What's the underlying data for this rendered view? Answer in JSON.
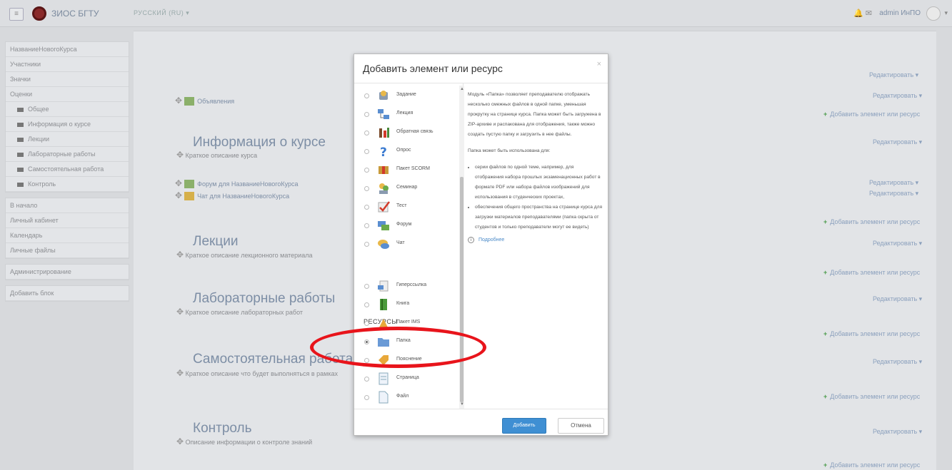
{
  "header": {
    "menu_icon": "menu-icon",
    "logo_icon": "university-seal-logo",
    "brand": "ЗИОС БГТУ",
    "language": "РУССКИЙ (RU) ▾",
    "user": "admin ИнПО",
    "dropdown": "▾"
  },
  "sidebar": {
    "course": [
      "НазваниеНовогоКурса",
      "Участники",
      "Значки",
      "Оценки",
      "Общее",
      "Информация о курсе",
      "Лекции",
      "Лабораторные работы",
      "Самостоятельная работа",
      "Контроль"
    ],
    "nav": [
      "В начало",
      "Личный кабинет",
      "Календарь",
      "Личные файлы"
    ],
    "admin": "Администрирование",
    "addblock": "Добавить блок"
  },
  "main": {
    "edit": "Редактировать ▾",
    "add": "Добавить элемент или ресурс",
    "news": "Объявления",
    "sections": [
      {
        "title": "Информация о курсе",
        "summary": "Краткое описание курса"
      },
      {
        "title": "Лекции",
        "summary": "Краткое описание лекционного материала"
      },
      {
        "title": "Лабораторные работы",
        "summary": "Краткое описание лабораторных работ"
      },
      {
        "title": "Самостоятельная работа",
        "summary": "Краткое описание что будет выполняться в рамках"
      },
      {
        "title": "Контроль",
        "summary": "Описание информации о контроле знаний"
      }
    ],
    "forum": "Форум для НазваниеНовогоКурса",
    "chat": "Чат для НазваниеНовогоКурса"
  },
  "modal": {
    "title": "Добавить элемент или ресурс",
    "close": "×",
    "resources_heading": "РЕСУРСЫ",
    "activities": [
      "Задание",
      "Лекция",
      "Обратная связь",
      "Опрос",
      "Пакет SCORM",
      "Семинар",
      "Тест",
      "Форум",
      "Чат"
    ],
    "resources": [
      "Гиперссылка",
      "Книга",
      "Пакет IMS",
      "Папка",
      "Пояснение",
      "Страница",
      "Файл"
    ],
    "selected": "Папка",
    "description": {
      "p1": "Модуль «Папка» позволяет преподавателю отображать несколько смежных файлов в одной папке, уменьшая прокрутку на странице курса. Папка может быть загружена в ZIP-архиве и распакована для отображения, также можно создать пустую папку и загрузить в нее файлы.",
      "p2": "Папка может быть использована для:",
      "b1": "серии файлов по одной теме, например, для отображения набора прошлых экзаменационных работ в формате PDF или набора файлов изображений для использования в студенческих проектах,",
      "b2": "обеспечения общего пространства на странице курса для загрузки материалов преподавателями (папка скрыта от студентов и только преподаватели могут ее видеть)",
      "more": "Подробнее"
    },
    "add_button": "Добавить",
    "cancel_button": "Отмена"
  }
}
